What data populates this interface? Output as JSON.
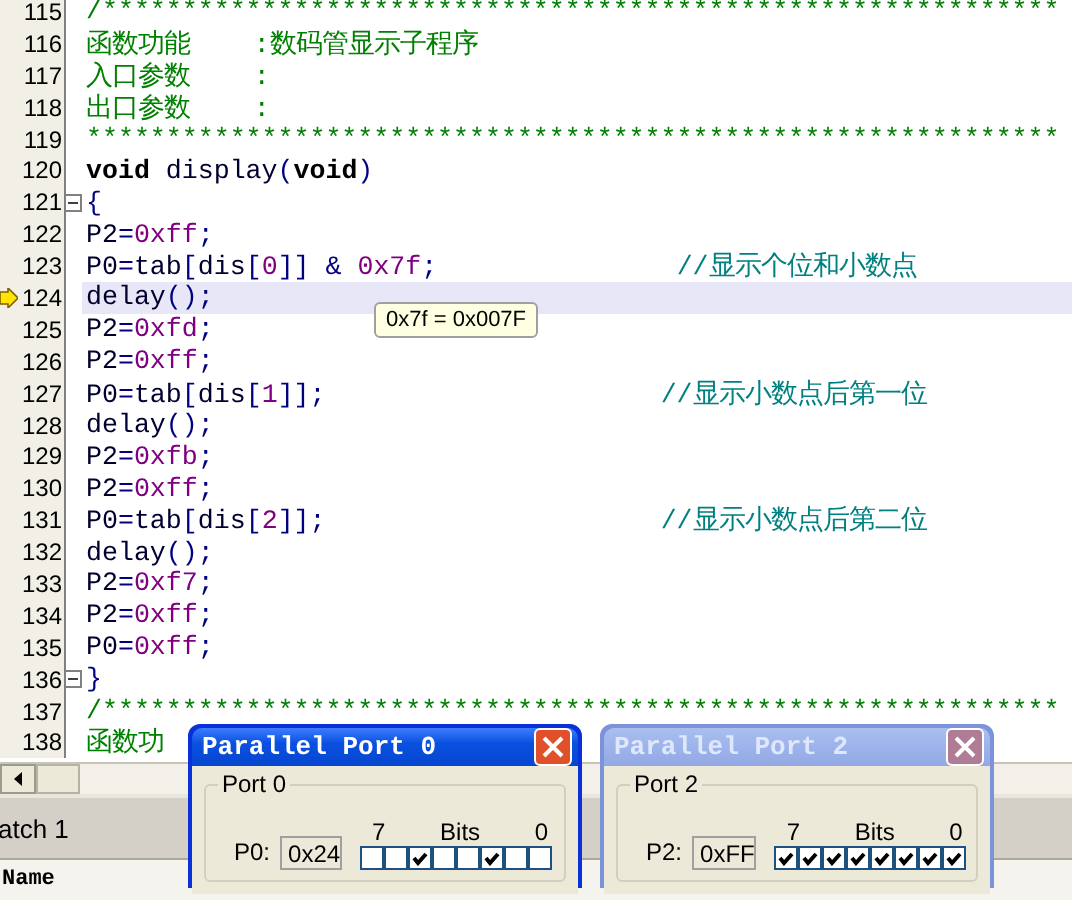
{
  "editor": {
    "lines": [
      {
        "number": "115",
        "current": false,
        "fold_box": false,
        "tokens": [
          {
            "kind": "comment",
            "text": "/************************************************************"
          }
        ]
      },
      {
        "number": "116",
        "current": false,
        "fold_box": false,
        "tokens": [
          {
            "kind": "comment",
            "text": "函数功能    :数码管显示子程序"
          }
        ]
      },
      {
        "number": "117",
        "current": false,
        "fold_box": false,
        "tokens": [
          {
            "kind": "comment",
            "text": "入口参数    :"
          }
        ]
      },
      {
        "number": "118",
        "current": false,
        "fold_box": false,
        "tokens": [
          {
            "kind": "comment",
            "text": "出口参数    :"
          }
        ]
      },
      {
        "number": "119",
        "current": false,
        "fold_box": false,
        "tokens": [
          {
            "kind": "comment",
            "text": "*************************************************************"
          }
        ]
      },
      {
        "number": "120",
        "current": false,
        "fold_box": false,
        "tokens": [
          {
            "kind": "keyword",
            "text": "void"
          },
          {
            "kind": "ident",
            "text": " display"
          },
          {
            "kind": "op",
            "text": "("
          },
          {
            "kind": "keyword",
            "text": "void"
          },
          {
            "kind": "op",
            "text": ")"
          }
        ]
      },
      {
        "number": "121",
        "current": false,
        "fold_box": true,
        "tokens": [
          {
            "kind": "op",
            "text": "{"
          }
        ]
      },
      {
        "number": "122",
        "current": false,
        "fold_box": false,
        "tokens": [
          {
            "kind": "ident",
            "text": "P2"
          },
          {
            "kind": "op",
            "text": "="
          },
          {
            "kind": "number",
            "text": "0xff"
          },
          {
            "kind": "op",
            "text": ";"
          }
        ]
      },
      {
        "number": "123",
        "current": false,
        "fold_box": false,
        "tokens": [
          {
            "kind": "ident",
            "text": "P0"
          },
          {
            "kind": "op",
            "text": "="
          },
          {
            "kind": "ident",
            "text": "tab"
          },
          {
            "kind": "op",
            "text": "["
          },
          {
            "kind": "ident",
            "text": "dis"
          },
          {
            "kind": "op",
            "text": "["
          },
          {
            "kind": "number",
            "text": "0"
          },
          {
            "kind": "op",
            "text": "]] & "
          },
          {
            "kind": "number",
            "text": "0x7f"
          },
          {
            "kind": "op",
            "text": ";               "
          },
          {
            "kind": "linecomment",
            "text": "//显示个位和小数点"
          }
        ]
      },
      {
        "number": "124",
        "current": true,
        "fold_box": false,
        "tokens": [
          {
            "kind": "ident",
            "text": "delay"
          },
          {
            "kind": "op",
            "text": "();"
          }
        ]
      },
      {
        "number": "125",
        "current": false,
        "fold_box": false,
        "tokens": [
          {
            "kind": "ident",
            "text": "P2"
          },
          {
            "kind": "op",
            "text": "="
          },
          {
            "kind": "number",
            "text": "0xfd"
          },
          {
            "kind": "op",
            "text": ";"
          }
        ]
      },
      {
        "number": "126",
        "current": false,
        "fold_box": false,
        "tokens": [
          {
            "kind": "ident",
            "text": "P2"
          },
          {
            "kind": "op",
            "text": "="
          },
          {
            "kind": "number",
            "text": "0xff"
          },
          {
            "kind": "op",
            "text": ";"
          }
        ]
      },
      {
        "number": "127",
        "current": false,
        "fold_box": false,
        "tokens": [
          {
            "kind": "ident",
            "text": "P0"
          },
          {
            "kind": "op",
            "text": "="
          },
          {
            "kind": "ident",
            "text": "tab"
          },
          {
            "kind": "op",
            "text": "["
          },
          {
            "kind": "ident",
            "text": "dis"
          },
          {
            "kind": "op",
            "text": "["
          },
          {
            "kind": "number",
            "text": "1"
          },
          {
            "kind": "op",
            "text": "]];                     "
          },
          {
            "kind": "linecomment",
            "text": "//显示小数点后第一位"
          }
        ]
      },
      {
        "number": "128",
        "current": false,
        "fold_box": false,
        "tokens": [
          {
            "kind": "ident",
            "text": "delay"
          },
          {
            "kind": "op",
            "text": "();"
          }
        ]
      },
      {
        "number": "129",
        "current": false,
        "fold_box": false,
        "tokens": [
          {
            "kind": "ident",
            "text": "P2"
          },
          {
            "kind": "op",
            "text": "="
          },
          {
            "kind": "number",
            "text": "0xfb"
          },
          {
            "kind": "op",
            "text": ";"
          }
        ]
      },
      {
        "number": "130",
        "current": false,
        "fold_box": false,
        "tokens": [
          {
            "kind": "ident",
            "text": "P2"
          },
          {
            "kind": "op",
            "text": "="
          },
          {
            "kind": "number",
            "text": "0xff"
          },
          {
            "kind": "op",
            "text": ";"
          }
        ]
      },
      {
        "number": "131",
        "current": false,
        "fold_box": false,
        "tokens": [
          {
            "kind": "ident",
            "text": "P0"
          },
          {
            "kind": "op",
            "text": "="
          },
          {
            "kind": "ident",
            "text": "tab"
          },
          {
            "kind": "op",
            "text": "["
          },
          {
            "kind": "ident",
            "text": "dis"
          },
          {
            "kind": "op",
            "text": "["
          },
          {
            "kind": "number",
            "text": "2"
          },
          {
            "kind": "op",
            "text": "]];                     "
          },
          {
            "kind": "linecomment",
            "text": "//显示小数点后第二位"
          }
        ]
      },
      {
        "number": "132",
        "current": false,
        "fold_box": false,
        "tokens": [
          {
            "kind": "ident",
            "text": "delay"
          },
          {
            "kind": "op",
            "text": "();"
          }
        ]
      },
      {
        "number": "133",
        "current": false,
        "fold_box": false,
        "tokens": [
          {
            "kind": "ident",
            "text": "P2"
          },
          {
            "kind": "op",
            "text": "="
          },
          {
            "kind": "number",
            "text": "0xf7"
          },
          {
            "kind": "op",
            "text": ";"
          }
        ]
      },
      {
        "number": "134",
        "current": false,
        "fold_box": false,
        "tokens": [
          {
            "kind": "ident",
            "text": "P2"
          },
          {
            "kind": "op",
            "text": "="
          },
          {
            "kind": "number",
            "text": "0xff"
          },
          {
            "kind": "op",
            "text": ";"
          }
        ]
      },
      {
        "number": "135",
        "current": false,
        "fold_box": false,
        "tokens": [
          {
            "kind": "ident",
            "text": "P0"
          },
          {
            "kind": "op",
            "text": "="
          },
          {
            "kind": "number",
            "text": "0xff"
          },
          {
            "kind": "op",
            "text": ";"
          }
        ]
      },
      {
        "number": "136",
        "current": false,
        "fold_box": true,
        "tokens": [
          {
            "kind": "op",
            "text": "}"
          }
        ]
      },
      {
        "number": "137",
        "current": false,
        "fold_box": false,
        "tokens": [
          {
            "kind": "comment",
            "text": "/************************************************************"
          }
        ]
      },
      {
        "number": "138",
        "current": false,
        "fold_box": false,
        "tokens": [
          {
            "kind": "comment",
            "text": "函数功"
          }
        ]
      }
    ]
  },
  "tooltip": {
    "text": "0x7f = 0x007F"
  },
  "watch": {
    "tab": "atch 1",
    "column": "Name"
  },
  "dialogs": [
    {
      "title": "Parallel Port 0",
      "active": true,
      "group": "Port 0",
      "label": "P0:",
      "value": "0x24",
      "bit_high": "7",
      "bits_caption": "Bits",
      "bit_low": "0",
      "bits": [
        {
          "checked": false
        },
        {
          "checked": false
        },
        {
          "checked": true
        },
        {
          "checked": false
        },
        {
          "checked": false
        },
        {
          "checked": true
        },
        {
          "checked": false
        },
        {
          "checked": false
        }
      ]
    },
    {
      "title": "Parallel Port 2",
      "active": false,
      "group": "Port 2",
      "label": "P2:",
      "value": "0xFF",
      "bit_high": "7",
      "bits_caption": "Bits",
      "bit_low": "0",
      "bits": [
        {
          "checked": true
        },
        {
          "checked": true
        },
        {
          "checked": true
        },
        {
          "checked": true
        },
        {
          "checked": true
        },
        {
          "checked": true
        },
        {
          "checked": true
        },
        {
          "checked": true
        }
      ]
    }
  ]
}
